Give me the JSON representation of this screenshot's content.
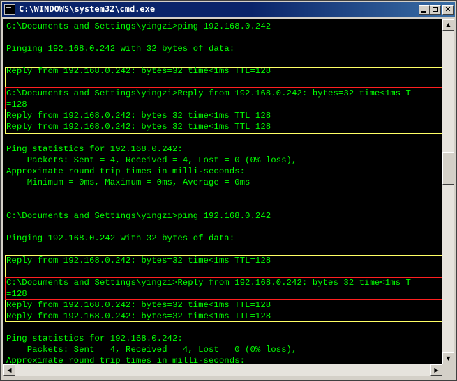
{
  "window": {
    "title": "C:\\WINDOWS\\system32\\cmd.exe",
    "icon": "console-icon",
    "controls": [
      "minimize-icon",
      "maximize-icon",
      "close-icon"
    ]
  },
  "console": {
    "text_color": "#00ff00",
    "background": "#000000",
    "lines": [
      "C:\\Documents and Settings\\yingzi>ping 192.168.0.242",
      "",
      "Pinging 192.168.0.242 with 32 bytes of data:",
      "",
      "Reply from 192.168.0.242: bytes=32 time<1ms TTL=128",
      "",
      "C:\\Documents and Settings\\yingzi>Reply from 192.168.0.242: bytes=32 time<1ms T",
      "=128",
      "Reply from 192.168.0.242: bytes=32 time<1ms TTL=128",
      "Reply from 192.168.0.242: bytes=32 time<1ms TTL=128",
      "",
      "Ping statistics for 192.168.0.242:",
      "    Packets: Sent = 4, Received = 4, Lost = 0 (0% loss),",
      "Approximate round trip times in milli-seconds:",
      "    Minimum = 0ms, Maximum = 0ms, Average = 0ms",
      "",
      "",
      "C:\\Documents and Settings\\yingzi>ping 192.168.0.242",
      "",
      "Pinging 192.168.0.242 with 32 bytes of data:",
      "",
      "Reply from 192.168.0.242: bytes=32 time<1ms TTL=128",
      "",
      "C:\\Documents and Settings\\yingzi>Reply from 192.168.0.242: bytes=32 time<1ms T",
      "=128",
      "Reply from 192.168.0.242: bytes=32 time<1ms TTL=128",
      "Reply from 192.168.0.242: bytes=32 time<1ms TTL=128",
      "",
      "Ping statistics for 192.168.0.242:",
      "    Packets: Sent = 4, Received = 4, Lost = 0 (0% loss),",
      "Approximate round trip times in milli-seconds:"
    ]
  },
  "scrollbars": {
    "vertical_position_fraction": 0.42
  }
}
